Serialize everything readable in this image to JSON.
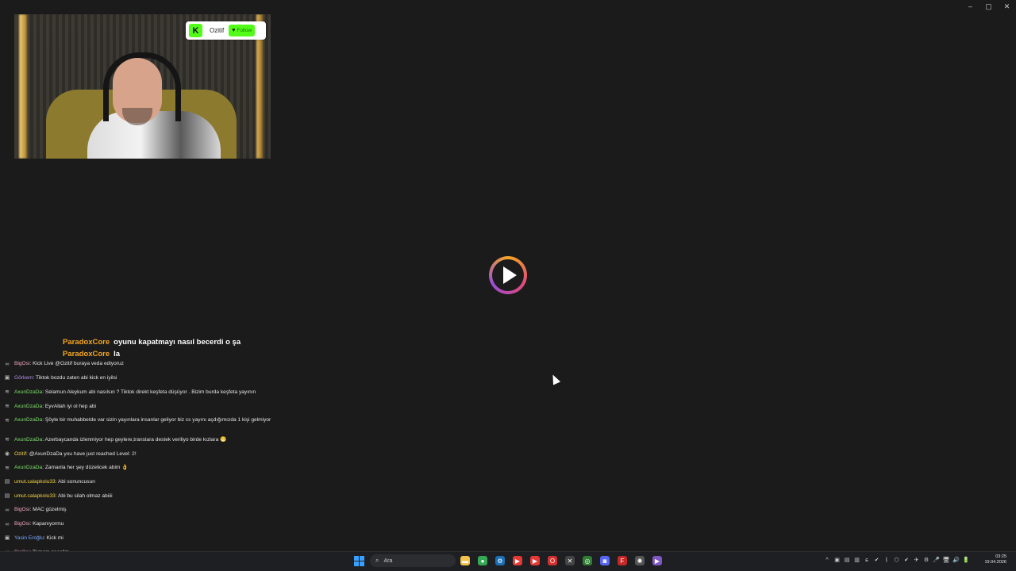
{
  "window": {
    "minimize": "–",
    "maximize": "▢",
    "close": "✕"
  },
  "kick_badge": {
    "logo": "K",
    "name": "Ozitif",
    "follow": "Follow",
    "color": "#53fc18"
  },
  "overlay_messages": [
    {
      "user": "ParadoxCore",
      "text": "oyunu kapatmayı nasıl becerdi o şa"
    },
    {
      "user": "ParadoxCore",
      "text": "la"
    }
  ],
  "chat": [
    {
      "user": "BigOsi",
      "color": "#f2a5c2",
      "text": "Kick Live @Ozitif buraya veda ediyoruz",
      "avatar": "∞"
    },
    {
      "user": "Görkem",
      "color": "#b48be8",
      "text": "Tiktok bozdu zaten abi kick en iyilsi",
      "avatar": "▣"
    },
    {
      "user": "AxunDzaDa",
      "color": "#7ee06b",
      "text": "Selamun Aleykum abi nasılsın ? Tiktok direkt keşfeta düşüyor . Bizim burda keşfeta yayının",
      "avatar": "≋"
    },
    {
      "user": "AxunDzaDa",
      "color": "#7ee06b",
      "text": "EyvAllah iyi ol hep abi",
      "avatar": "≋"
    },
    {
      "user": "AxunDzaDa",
      "color": "#7ee06b",
      "text": "Şöyle bir muhabbetde var sizin yayınlara insanlar geliyor biz cs yayını açdığımızda 1 kişi gelmiyor",
      "avatar": "≋"
    },
    {
      "user": "AxunDzaDa",
      "color": "#7ee06b",
      "text": "Azerbaycanda izlenmiyor hep geylere,translara destek veriliyo birde kızlara 😁",
      "avatar": "≋"
    },
    {
      "user": "Ozitif",
      "color": "#f5d442",
      "text": "@AxunDzaDa you have just reached Level: 2!",
      "avatar": "◉"
    },
    {
      "user": "AxunDzaDa",
      "color": "#7ee06b",
      "text": "Zamanla her şey düzelicek abim 👌",
      "avatar": "≋"
    },
    {
      "user": "umut.calapkolu33",
      "color": "#f5d442",
      "text": "Abi sonuncusun",
      "avatar": "▤"
    },
    {
      "user": "umut.calapkolu33",
      "color": "#f5d442",
      "text": "Abi bu silah olmaz abiiii",
      "avatar": "▤"
    },
    {
      "user": "BigOsi",
      "color": "#f2a5c2",
      "text": "MAC güzelmiş",
      "avatar": "∞"
    },
    {
      "user": "BigOsi",
      "color": "#f2a5c2",
      "text": "Kapanıyormu",
      "avatar": "∞"
    },
    {
      "user": "Yasin Eroğlu",
      "color": "#7aa8ff",
      "text": "Kick mi",
      "avatar": "▣"
    },
    {
      "user": "BigOsi",
      "color": "#f2a5c2",
      "text": "Tamam geçelim",
      "avatar": "∞"
    }
  ],
  "taskbar": {
    "search_placeholder": "Ara",
    "apps": [
      {
        "name": "file-explorer-icon",
        "glyph": "▬",
        "color": "#f2c14e"
      },
      {
        "name": "chrome-icon",
        "glyph": "●",
        "color": "#34a853"
      },
      {
        "name": "steam-icon",
        "glyph": "⚙",
        "color": "#1b6fb5"
      },
      {
        "name": "media-player-icon",
        "glyph": "▶",
        "color": "#e53935"
      },
      {
        "name": "youtube-icon",
        "glyph": "▶",
        "color": "#e53935"
      },
      {
        "name": "opera-icon",
        "glyph": "O",
        "color": "#d32f2f"
      },
      {
        "name": "capcut-icon",
        "glyph": "✕",
        "color": "#444444"
      },
      {
        "name": "xbox-icon",
        "glyph": "◎",
        "color": "#2e7d32"
      },
      {
        "name": "discord-icon",
        "glyph": "◙",
        "color": "#5865f2"
      },
      {
        "name": "font-app-icon",
        "glyph": "F",
        "color": "#c62828"
      },
      {
        "name": "settings-app-icon",
        "glyph": "✺",
        "color": "#555555"
      },
      {
        "name": "streaming-app-icon",
        "glyph": "▶",
        "color": "#7e57c2"
      }
    ],
    "tray": [
      "^",
      "▣",
      "▤",
      "▥",
      "ɕ",
      "✔",
      "ᛒ",
      "⬡",
      "✔",
      "✈",
      "⚙",
      "🎤",
      "🖥",
      "🔊",
      "🔋"
    ],
    "time": "03:25",
    "date": "19.04.2026"
  }
}
